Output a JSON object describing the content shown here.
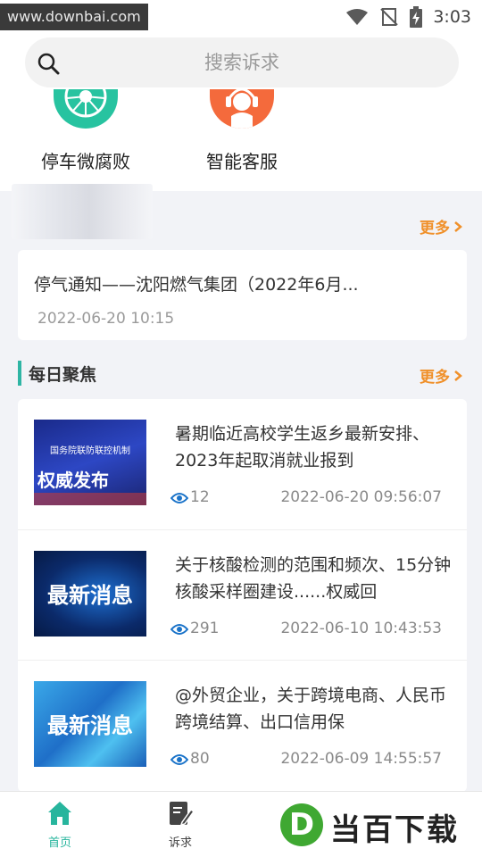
{
  "status_bar": {
    "watermark": "www.downbai.com",
    "time": "3:03",
    "icons": [
      "wifi-icon",
      "no-signal-icon",
      "battery-charging-icon"
    ]
  },
  "search": {
    "placeholder": "搜索诉求",
    "icon": "search-icon"
  },
  "quick_entries": [
    {
      "label": "停车微腐败",
      "icon": "wheel-icon",
      "color": "#27c3a0"
    },
    {
      "label": "智能客服",
      "icon": "headset-icon",
      "color": "#f46a3c"
    }
  ],
  "notices": {
    "more_label": "更多",
    "item": {
      "title": "停气通知——沈阳燃气集团（2022年6月...",
      "time": "2022-06-20 10:15"
    }
  },
  "daily_focus": {
    "title": "每日聚焦",
    "more_label": "更多",
    "items": [
      {
        "title": "暑期临近高校学生返乡最新安排、2023年起取消就业报到",
        "views": "12",
        "time": "2022-06-20 09:56:07",
        "thumb_text": "权威发布",
        "thumb_sub": "国务院联防联控机制"
      },
      {
        "title": "关于核酸检测的范围和频次、15分钟核酸采样圈建设......权威回",
        "views": "291",
        "time": "2022-06-10 10:43:53",
        "thumb_text": "最新消息"
      },
      {
        "title": "@外贸企业，关于跨境电商、人民币跨境结算、出口信用保",
        "views": "80",
        "time": "2022-06-09 14:55:57",
        "thumb_text": "最新消息"
      }
    ]
  },
  "tabbar": {
    "tabs": [
      {
        "label": "首页",
        "icon": "home-icon",
        "active": true
      },
      {
        "label": "诉求",
        "icon": "edit-icon",
        "active": false
      }
    ],
    "active_color": "#27b59d",
    "inactive_color": "#444444"
  },
  "brand_watermark": {
    "letter": "D",
    "text": "当百下载"
  }
}
